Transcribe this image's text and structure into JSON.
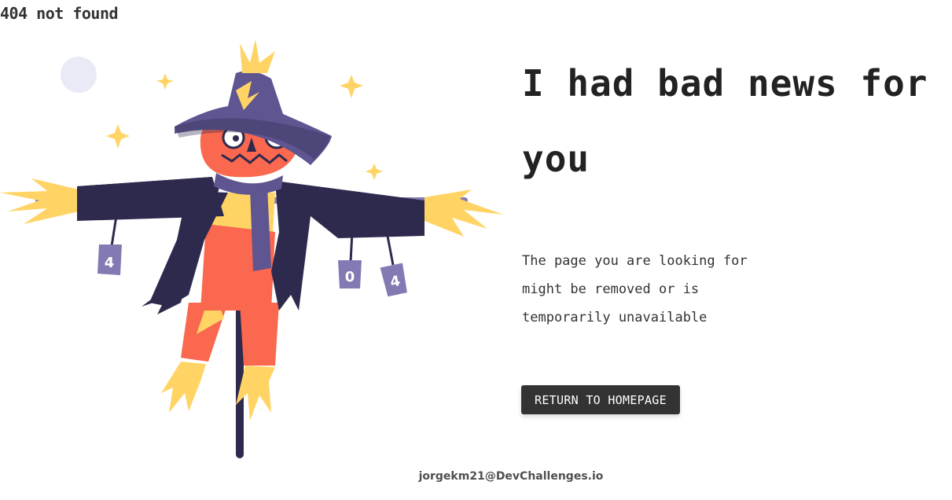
{
  "header": {
    "brand": "404 not found"
  },
  "illustration": {
    "name": "scarecrow-404",
    "can_labels": [
      "4",
      "0",
      "4"
    ],
    "colors": {
      "hat": "#5e5591",
      "coat": "#2e2a4e",
      "face": "#f9684f",
      "straw": "#ffd465",
      "scarf": "#5e5591",
      "pants": "#f9684f",
      "cans": "#837ab3",
      "moon": "#e8eaf5"
    }
  },
  "main": {
    "headline": "I had bad news for you",
    "message": "The page you are looking for might be removed or is temporarily unavailable",
    "button_label": "RETURN TO HOMEPAGE"
  },
  "footer": {
    "credit": "jorgekm21@DevChallenges.io"
  }
}
